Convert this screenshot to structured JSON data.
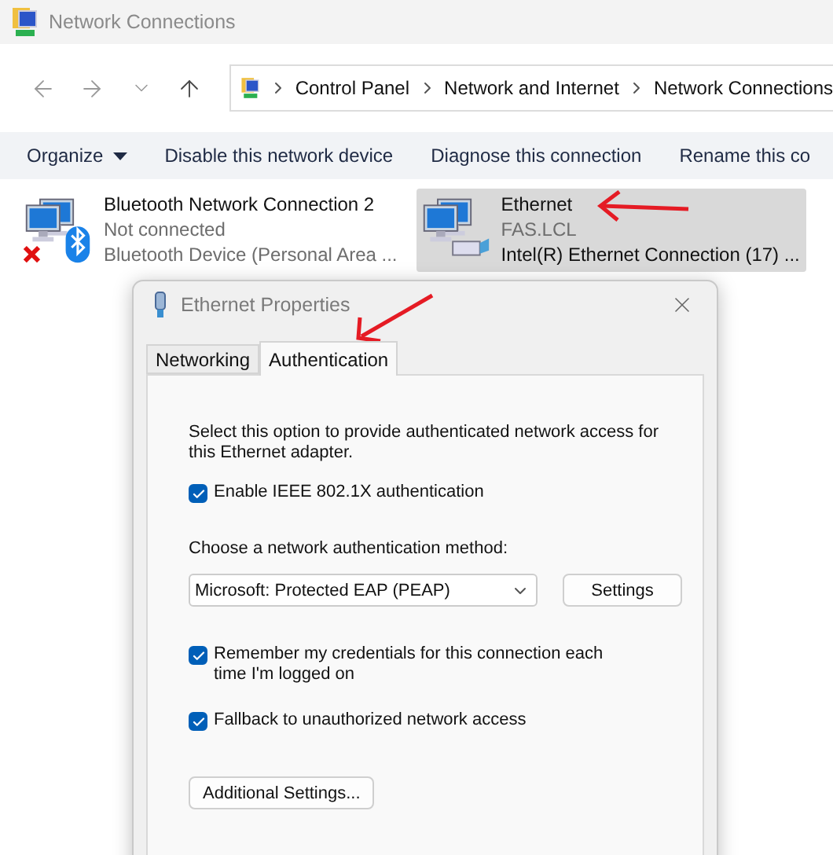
{
  "window": {
    "title": "Network Connections"
  },
  "breadcrumb": [
    "Control Panel",
    "Network and Internet",
    "Network Connections"
  ],
  "commands": [
    {
      "label": "Organize",
      "kind": "menu"
    },
    {
      "label": "Disable this network device",
      "kind": "action"
    },
    {
      "label": "Diagnose this connection",
      "kind": "action"
    },
    {
      "label": "Rename this co",
      "kind": "action"
    }
  ],
  "connections": [
    {
      "kind": "bluetooth",
      "name": "Bluetooth Network Connection 2",
      "status": "Not connected",
      "device": "Bluetooth Device (Personal Area ...",
      "disconnected": true,
      "selected": false
    },
    {
      "kind": "ethernet",
      "name": "Ethernet",
      "status": "FAS.LCL",
      "device": "Intel(R) Ethernet Connection (17) ...",
      "disconnected": false,
      "selected": true
    }
  ],
  "dialog": {
    "title": "Ethernet Properties",
    "tabs": [
      {
        "label": "Networking",
        "selected": false
      },
      {
        "label": "Authentication",
        "selected": true
      }
    ],
    "description": "Select this option to provide authenticated network access for this Ethernet adapter.",
    "enable": {
      "label": "Enable IEEE 802.1X authentication",
      "checked": true
    },
    "method_label": "Choose a network authentication method:",
    "method": {
      "value": "Microsoft: Protected EAP (PEAP)"
    },
    "settings_button": "Settings",
    "options": [
      {
        "label": "Remember my credentials for this connection each time I'm logged on",
        "checked": true
      },
      {
        "label": "Fallback to unauthorized network access",
        "checked": true
      }
    ],
    "additional_button": "Additional Settings..."
  }
}
